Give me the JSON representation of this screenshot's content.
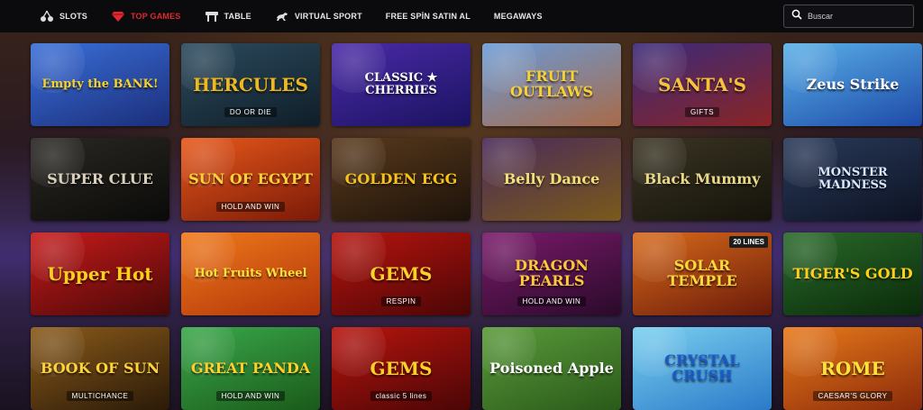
{
  "nav": {
    "items": [
      {
        "label": "SLOTS",
        "icon": "cherries-icon",
        "active": false
      },
      {
        "label": "TOP GAMES",
        "icon": "diamond-icon",
        "active": true
      },
      {
        "label": "TABLE",
        "icon": "table-icon",
        "active": false
      },
      {
        "label": "VIRTUAL SPORT",
        "icon": "horse-icon",
        "active": false
      },
      {
        "label": "FREE SPİN SATIN AL",
        "icon": "",
        "active": false
      },
      {
        "label": "MEGAWAYS",
        "icon": "",
        "active": false
      }
    ],
    "search_placeholder": "Buscar",
    "active_color": "#e0282e"
  },
  "games": [
    {
      "title": "Empty the BANK!",
      "sub": "",
      "badge": "",
      "bg": [
        "#3a6fd8",
        "#1b2e7a"
      ],
      "color": "#f6d32a"
    },
    {
      "title": "HERCULES",
      "sub": "DO OR DIE",
      "badge": "",
      "bg": [
        "#2c4a5e",
        "#0f1e28"
      ],
      "color": "#f0b81c"
    },
    {
      "title": "CLASSIC ★ CHERRIES",
      "sub": "",
      "badge": "",
      "bg": [
        "#4b2aa8",
        "#1a1360"
      ],
      "color": "#ffffff"
    },
    {
      "title": "FRUIT OUTLAWS",
      "sub": "",
      "badge": "",
      "bg": [
        "#6a9bd8",
        "#a86a48"
      ],
      "color": "#f7d13a"
    },
    {
      "title": "SANTA'S",
      "sub": "GIFTS",
      "badge": "",
      "bg": [
        "#3a2a7a",
        "#8a2424"
      ],
      "color": "#f7c23a"
    },
    {
      "title": "Zeus Strike",
      "sub": "",
      "badge": "",
      "bg": [
        "#5ab0e8",
        "#1d4aa8"
      ],
      "color": "#ffffff"
    },
    {
      "title": "SUPER CLUE",
      "sub": "",
      "badge": "",
      "bg": [
        "#2a2824",
        "#0a0a08"
      ],
      "color": "#d8d0bc"
    },
    {
      "title": "SUN OF EGYPT",
      "sub": "HOLD AND WIN",
      "badge": "",
      "bg": [
        "#e8581a",
        "#7a1a08"
      ],
      "color": "#ffd23a"
    },
    {
      "title": "GOLDEN EGG",
      "sub": "",
      "badge": "",
      "bg": [
        "#5a3a1c",
        "#1c120a"
      ],
      "color": "#f7c21c"
    },
    {
      "title": "Belly Dance",
      "sub": "",
      "badge": "",
      "bg": [
        "#4a2a5a",
        "#7a5a1a"
      ],
      "color": "#f0e07a"
    },
    {
      "title": "Black Mummy",
      "sub": "",
      "badge": "",
      "bg": [
        "#3a3422",
        "#15130b"
      ],
      "color": "#e8d88a"
    },
    {
      "title": "MONSTER MADNESS",
      "sub": "",
      "badge": "",
      "bg": [
        "#2a3a5a",
        "#0c1222"
      ],
      "color": "#d8e8ff"
    },
    {
      "title": "Upper Hot",
      "sub": "",
      "badge": "",
      "bg": [
        "#c81a1a",
        "#4a0808"
      ],
      "color": "#ffcf1a"
    },
    {
      "title": "Hot Fruits Wheel",
      "sub": "",
      "badge": "",
      "bg": [
        "#f07a1a",
        "#b0340a"
      ],
      "color": "#ffe23a"
    },
    {
      "title": "GEMS",
      "sub": "RESPIN",
      "badge": "",
      "bg": [
        "#b8140e",
        "#4a0606"
      ],
      "color": "#ffcf2a"
    },
    {
      "title": "DRAGON PEARLS",
      "sub": "HOLD AND WIN",
      "badge": "",
      "bg": [
        "#7a1a6a",
        "#2a0a2a"
      ],
      "color": "#ffc83a"
    },
    {
      "title": "SOLAR TEMPLE",
      "sub": "",
      "badge": "20 LINES",
      "bg": [
        "#d86a1a",
        "#6a1a0a"
      ],
      "color": "#ffd83a"
    },
    {
      "title": "TIGER'S GOLD",
      "sub": "",
      "badge": "",
      "bg": [
        "#2a6a2a",
        "#0a2a0a"
      ],
      "color": "#ffcf1a"
    },
    {
      "title": "BOOK OF SUN",
      "sub": "MULTICHANCE",
      "badge": "",
      "bg": [
        "#8a5a1a",
        "#2a1a08"
      ],
      "color": "#ffd23a"
    },
    {
      "title": "GREAT PANDA",
      "sub": "HOLD AND WIN",
      "badge": "",
      "bg": [
        "#3aa84a",
        "#1a5a1a"
      ],
      "color": "#ffcf2a"
    },
    {
      "title": "GEMS",
      "sub": "classic 5 lines",
      "badge": "",
      "bg": [
        "#b8140e",
        "#4a0606"
      ],
      "color": "#ffcf2a"
    },
    {
      "title": "Poisoned Apple",
      "sub": "",
      "badge": "",
      "bg": [
        "#5a9a3a",
        "#2a5a1a"
      ],
      "color": "#ffffff"
    },
    {
      "title": "CRYSTAL CRUSH",
      "sub": "",
      "badge": "",
      "bg": [
        "#7ad0f0",
        "#2a7ac8"
      ],
      "color": "#1a5ac8"
    },
    {
      "title": "ROME",
      "sub": "CAESAR'S GLORY",
      "badge": "",
      "bg": [
        "#e87a1a",
        "#8a2a0a"
      ],
      "color": "#ffe23a"
    }
  ]
}
